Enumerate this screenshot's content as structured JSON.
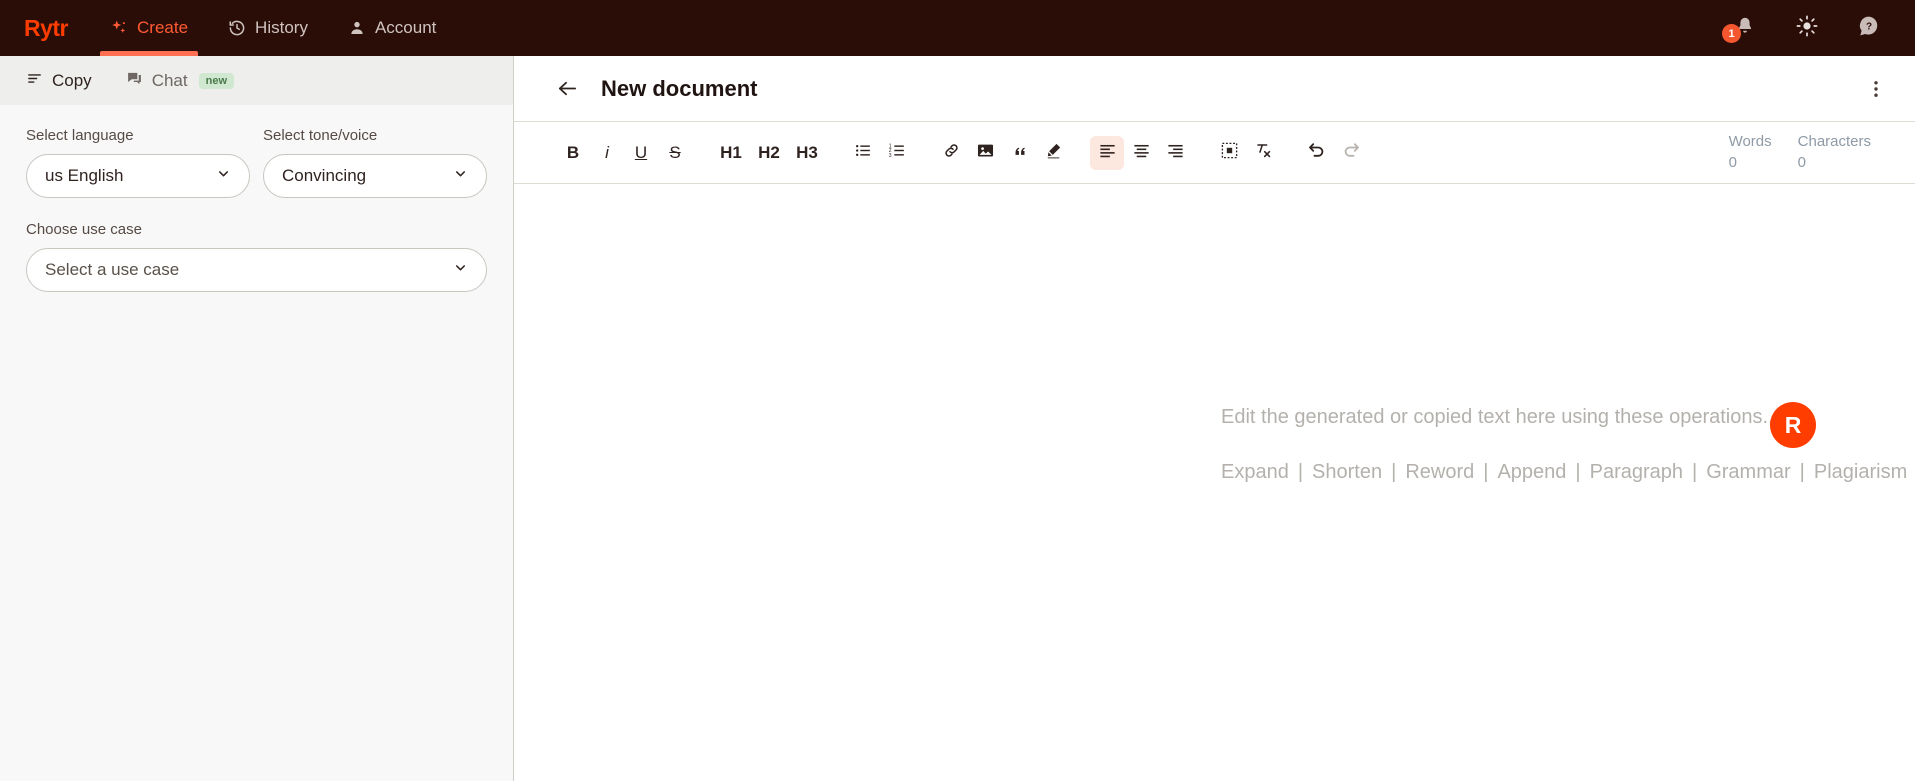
{
  "topnav": {
    "brand": "Rytr",
    "items": [
      {
        "label": "Create",
        "icon": "sparkle-icon",
        "active": true
      },
      {
        "label": "History",
        "icon": "history-icon",
        "active": false
      },
      {
        "label": "Account",
        "icon": "person-icon",
        "active": false
      }
    ],
    "notifications_count": "1",
    "icons": [
      "bell-icon",
      "sun-icon",
      "help-icon"
    ],
    "accent": "#ff5a33",
    "background": "#2a0d07"
  },
  "subtabs": [
    {
      "label": "Copy",
      "icon": "lines-icon",
      "active": true,
      "badge": ""
    },
    {
      "label": "Chat",
      "icon": "chat-icon",
      "active": false,
      "badge": "new"
    }
  ],
  "sidebar": {
    "language": {
      "label": "Select language",
      "value": "us English"
    },
    "tone": {
      "label": "Select tone/voice",
      "value": "Convincing"
    },
    "usecase": {
      "label": "Choose use case",
      "value": "Select a use case",
      "is_placeholder": true
    }
  },
  "document": {
    "title": "New document",
    "back_icon": "arrow-left-icon",
    "menu_icon": "kebab-menu-icon"
  },
  "toolbar": {
    "groups": [
      [
        {
          "name": "bold",
          "label": "B",
          "kind": "text",
          "style": "bold"
        },
        {
          "name": "italic",
          "label": "i",
          "kind": "text",
          "style": "italic"
        },
        {
          "name": "underline",
          "label": "U",
          "kind": "text",
          "style": "underline"
        },
        {
          "name": "strikethrough",
          "label": "S",
          "kind": "text",
          "style": "strike"
        }
      ],
      [
        {
          "name": "heading-1",
          "label": "H1",
          "kind": "heading"
        },
        {
          "name": "heading-2",
          "label": "H2",
          "kind": "heading"
        },
        {
          "name": "heading-3",
          "label": "H3",
          "kind": "heading"
        }
      ],
      [
        {
          "name": "bullet-list",
          "label": "",
          "kind": "icon",
          "icon": "bullet-list-icon"
        },
        {
          "name": "numbered-list",
          "label": "",
          "kind": "icon",
          "icon": "numbered-list-icon"
        }
      ],
      [
        {
          "name": "link",
          "label": "",
          "kind": "icon",
          "icon": "link-icon"
        },
        {
          "name": "image",
          "label": "",
          "kind": "icon",
          "icon": "image-icon"
        },
        {
          "name": "quote",
          "label": "",
          "kind": "icon",
          "icon": "quote-icon"
        },
        {
          "name": "highlighter",
          "label": "",
          "kind": "icon",
          "icon": "pen-icon"
        }
      ],
      [
        {
          "name": "align-left",
          "label": "",
          "kind": "icon",
          "icon": "align-left-icon",
          "active": true
        },
        {
          "name": "align-center",
          "label": "",
          "kind": "icon",
          "icon": "align-center-icon"
        },
        {
          "name": "align-right",
          "label": "",
          "kind": "icon",
          "icon": "align-right-icon"
        }
      ],
      [
        {
          "name": "insert-block",
          "label": "",
          "kind": "icon",
          "icon": "dashed-box-icon"
        },
        {
          "name": "clear-formatting",
          "label": "",
          "kind": "icon",
          "icon": "clear-format-icon"
        }
      ],
      [
        {
          "name": "undo",
          "label": "",
          "kind": "icon",
          "icon": "undo-icon"
        },
        {
          "name": "redo",
          "label": "",
          "kind": "icon",
          "icon": "redo-icon",
          "disabled": true
        }
      ]
    ],
    "counters": [
      {
        "label": "Words",
        "value": "0"
      },
      {
        "label": "Characters",
        "value": "0"
      }
    ]
  },
  "editor": {
    "placeholder": "Edit the generated or copied text here using these operations...",
    "operations": [
      "Expand",
      "Shorten",
      "Reword",
      "Append",
      "Paragraph",
      "Grammar",
      "Plagiarism"
    ],
    "separator": "|",
    "assistant_logo": "R"
  }
}
